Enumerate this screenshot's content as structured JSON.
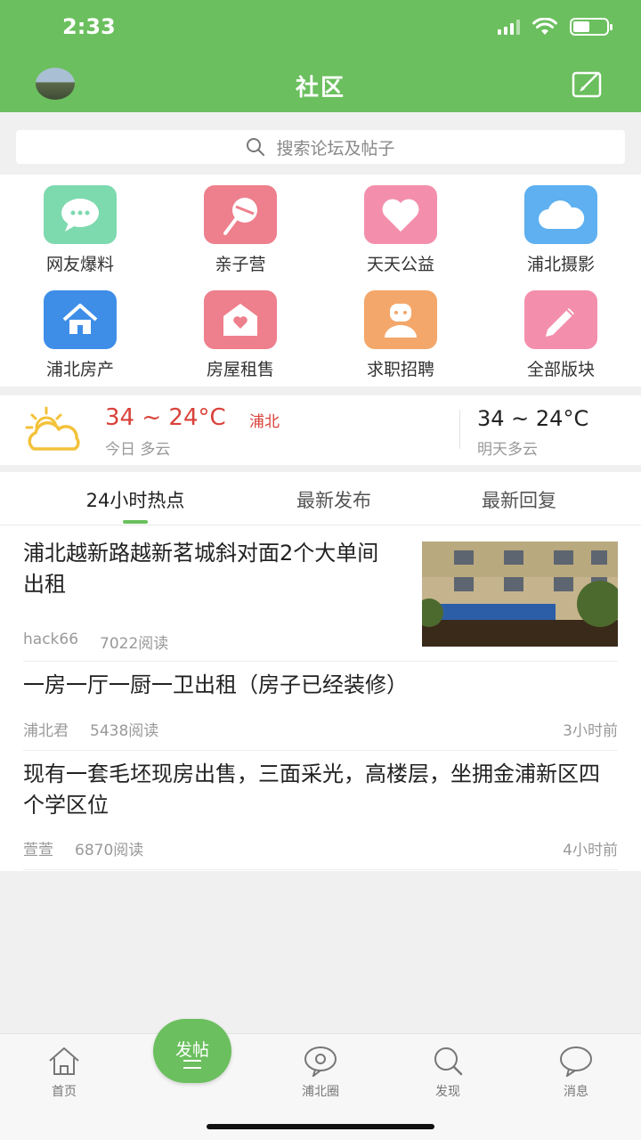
{
  "status_bar": {
    "time": "2:33"
  },
  "header": {
    "title": "社区"
  },
  "search": {
    "placeholder": "搜索论坛及帖子"
  },
  "categories": [
    {
      "label": "网友爆料",
      "icon": "chat-bubble-icon",
      "color": "#7dd9ae"
    },
    {
      "label": "亲子营",
      "icon": "lollipop-icon",
      "color": "#ee7f8c"
    },
    {
      "label": "天天公益",
      "icon": "heart-icon",
      "color": "#f38fac"
    },
    {
      "label": "浦北摄影",
      "icon": "cloud-icon",
      "color": "#5eb0f0"
    },
    {
      "label": "浦北房产",
      "icon": "house-icon",
      "color": "#3e8ee8"
    },
    {
      "label": "房屋租售",
      "icon": "house-heart-icon",
      "color": "#ee7f8c"
    },
    {
      "label": "求职招聘",
      "icon": "person-icon",
      "color": "#f4a76a"
    },
    {
      "label": "全部版块",
      "icon": "pencil-icon",
      "color": "#f38fac"
    }
  ],
  "weather": {
    "today_temp": "34 ~ 24°C",
    "location": "浦北",
    "today_desc": "今日 多云",
    "tomorrow_temp": "34 ~ 24°C",
    "tomorrow_desc": "明天多云"
  },
  "tabs": [
    {
      "label": "24小时热点",
      "active": true
    },
    {
      "label": "最新发布",
      "active": false
    },
    {
      "label": "最新回复",
      "active": false
    }
  ],
  "posts": [
    {
      "title": "浦北越新路越新茗城斜对面2个大单间出租",
      "author": "hack66",
      "reads": "7022阅读",
      "time": "",
      "has_image": true
    },
    {
      "title": "一房一厅一厨一卫出租（房子已经装修）",
      "author": "浦北君",
      "reads": "5438阅读",
      "time": "3小时前",
      "has_image": false
    },
    {
      "title": "现有一套毛坯现房出售，三面采光，高楼层，坐拥金浦新区四个学区位",
      "author": "萱萱",
      "reads": "6870阅读",
      "time": "4小时前",
      "has_image": false
    }
  ],
  "bottom_nav": {
    "items": [
      {
        "label": "首页",
        "icon": "home-icon"
      },
      {
        "label": "浦北圈",
        "icon": "circle-chat-icon"
      },
      {
        "label": "发现",
        "icon": "search-icon"
      },
      {
        "label": "消息",
        "icon": "message-icon"
      }
    ],
    "fab_label": "发帖"
  },
  "colors": {
    "brand_green": "#6bbf5e",
    "weather_red": "#d9413a"
  }
}
